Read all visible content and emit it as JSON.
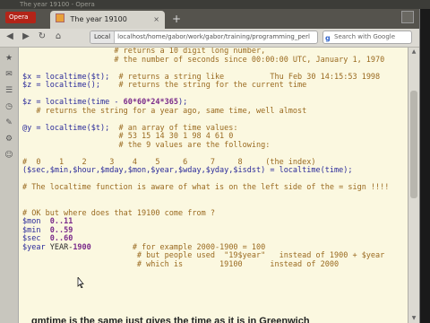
{
  "window": {
    "title": "The year 19100 - Opera"
  },
  "tabbar": {
    "menu_label": "Opera",
    "tab_title": "The year 19100",
    "tab_close": "×",
    "new_tab": "+"
  },
  "navbar": {
    "address_label": "Local",
    "url": "localhost/home/gabor/work/gabor/training/programming_perl",
    "search_placeholder": "Search with Google"
  },
  "icons": {
    "back": "◀",
    "forward": "▶",
    "reload": "↻",
    "home": "⌂",
    "search": "g",
    "sidebar": [
      "★",
      "✉",
      "☰",
      "◷",
      "✎",
      "⚙",
      "☺"
    ]
  },
  "colors": {
    "comment": "#9a6a20",
    "code": "#2a2a9a",
    "number": "#7a2a8a",
    "plain": "#2a2a2a",
    "page_bg": "#fbf8e0"
  },
  "code_lines": [
    [
      {
        "t": "                    # returns a 10 digit long number,",
        "c": "comment"
      }
    ],
    [
      {
        "t": "                    # the number of seconds since 00:00:00 UTC, January 1, 1970",
        "c": "comment"
      }
    ],
    [
      {
        "t": "",
        "c": "plain"
      }
    ],
    [
      {
        "t": "$x = localtime($t); ",
        "c": "code"
      },
      {
        "t": " # returns a string like          Thu Feb 30 14:15:53 1998",
        "c": "comment"
      }
    ],
    [
      {
        "t": "$z = localtime();   ",
        "c": "code"
      },
      {
        "t": " # returns the string for the current time",
        "c": "comment"
      }
    ],
    [
      {
        "t": "",
        "c": "plain"
      }
    ],
    [
      {
        "t": "$z = localtime(time - ",
        "c": "code"
      },
      {
        "t": "60*60*24*365",
        "c": "number"
      },
      {
        "t": ");",
        "c": "code"
      }
    ],
    [
      {
        "t": "   # returns the string for a year ago, same time, well almost",
        "c": "comment"
      }
    ],
    [
      {
        "t": "",
        "c": "plain"
      }
    ],
    [
      {
        "t": "@y = localtime($t); ",
        "c": "code"
      },
      {
        "t": " # an array of time values:",
        "c": "comment"
      }
    ],
    [
      {
        "t": "                     # 53 15 14 30 1 98 4 61 0",
        "c": "comment"
      }
    ],
    [
      {
        "t": "                     # the 9 values are the following:",
        "c": "comment"
      }
    ],
    [
      {
        "t": "",
        "c": "plain"
      }
    ],
    [
      {
        "t": "#  0    1    2     3    4    5     6     7     8     (the index)",
        "c": "comment"
      }
    ],
    [
      {
        "t": "($sec,$min,$hour,$mday,$mon,$year,$wday,$yday,$isdst) = localtime(time);",
        "c": "code"
      }
    ],
    [
      {
        "t": "",
        "c": "plain"
      }
    ],
    [
      {
        "t": "# The localtime function is aware of what is on the left side of the = sign !!!!",
        "c": "comment"
      }
    ],
    [
      {
        "t": "",
        "c": "plain"
      }
    ],
    [
      {
        "t": "",
        "c": "plain"
      }
    ],
    [
      {
        "t": "# OK but where does that 19100 come from ?",
        "c": "comment"
      }
    ],
    [
      {
        "t": "$mon  ",
        "c": "code"
      },
      {
        "t": "0..11",
        "c": "number"
      }
    ],
    [
      {
        "t": "$min  ",
        "c": "code"
      },
      {
        "t": "0..59",
        "c": "number"
      }
    ],
    [
      {
        "t": "$sec  ",
        "c": "code"
      },
      {
        "t": "0..60",
        "c": "number"
      }
    ],
    [
      {
        "t": "$year ",
        "c": "code"
      },
      {
        "t": "YEAR-",
        "c": "plain"
      },
      {
        "t": "1900",
        "c": "number"
      },
      {
        "t": "         # for example 2000-1900 = 100",
        "c": "comment"
      }
    ],
    [
      {
        "t": "                         # but people used  \"19$year\"   instead of 1900 + $year",
        "c": "comment"
      }
    ],
    [
      {
        "t": "                         # which is        19100      instead of 2000",
        "c": "comment"
      }
    ]
  ],
  "bottom_text": "gmtime is the same just gives the time as it is in Greenwich"
}
